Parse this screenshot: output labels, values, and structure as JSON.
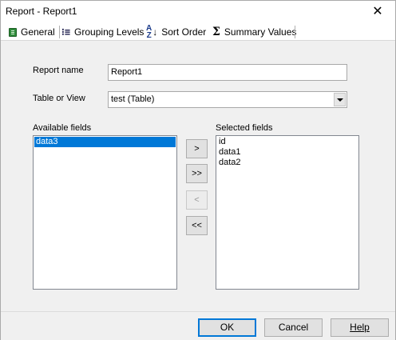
{
  "window": {
    "title": "Report - Report1",
    "close_glyph": "✕"
  },
  "tabs": [
    {
      "label": "General",
      "icon": "general-icon"
    },
    {
      "label": "Grouping Levels",
      "icon": "grouping-levels-icon"
    },
    {
      "label": "Sort Order",
      "icon": "sort-order-icon"
    },
    {
      "label": "Summary Values",
      "icon": "summary-values-icon"
    }
  ],
  "form": {
    "report_name_label": "Report name",
    "report_name_value": "Report1",
    "table_or_view_label": "Table or View",
    "table_or_view_value": "test (Table)"
  },
  "available": {
    "label": "Available fields",
    "items": [
      "data3"
    ],
    "selected_index": 0
  },
  "selected": {
    "label": "Selected fields",
    "items": [
      "id",
      "data1",
      "data2"
    ]
  },
  "move_buttons": {
    "add": ">",
    "add_all": ">>",
    "remove": "<",
    "remove_all": "<<"
  },
  "footer": {
    "ok": "OK",
    "cancel": "Cancel",
    "help": "Help"
  },
  "colors": {
    "selection": "#0078d7"
  }
}
